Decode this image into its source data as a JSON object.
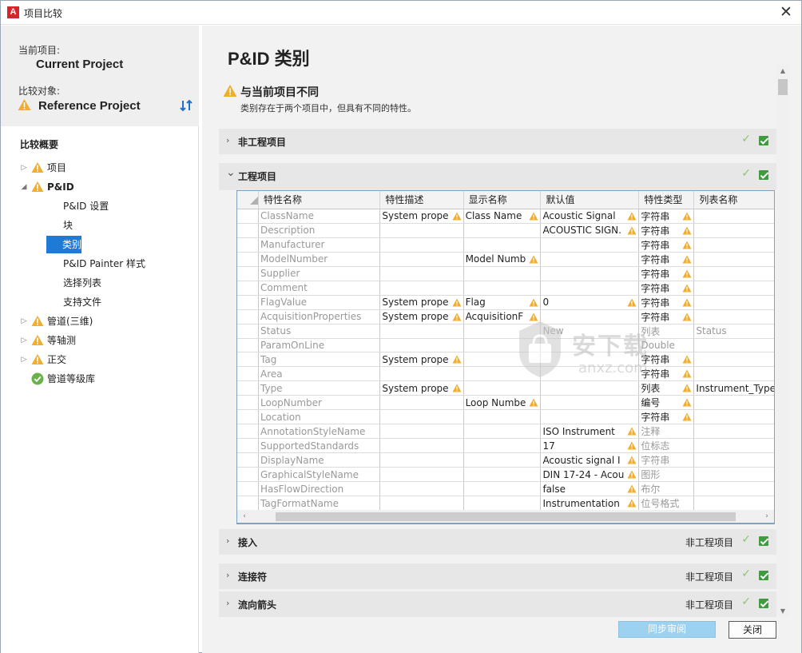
{
  "window": {
    "logo_letter": "A",
    "title": "项目比较",
    "close_glyph": "✕"
  },
  "left": {
    "current_label": "当前项目:",
    "current_name": "Current Project",
    "compare_label": "比较对象:",
    "compare_name": "Reference Project",
    "summary_title": "比较概要",
    "tree": [
      {
        "label": "项目",
        "icon": "warning-icon",
        "arrow": "▷"
      },
      {
        "label": "P&ID",
        "icon": "warning-icon",
        "arrow": "◢"
      },
      {
        "label": "管道(三维)",
        "icon": "warning-icon",
        "arrow": "▷"
      },
      {
        "label": "等轴测",
        "icon": "warning-icon",
        "arrow": "▷"
      },
      {
        "label": "正交",
        "icon": "warning-icon",
        "arrow": "▷"
      },
      {
        "label": "管道等级库",
        "icon": "check-circle-icon",
        "arrow": ""
      }
    ],
    "pid_children": [
      "P&ID 设置",
      "块",
      "类别",
      "P&ID Painter 样式",
      "选择列表",
      "支持文件"
    ],
    "selected_child": "类别"
  },
  "main": {
    "page_title": "P&ID 类别",
    "diff_title": "与当前项目不同",
    "diff_desc": "类别存在于两个项目中，但具有不同的特性。",
    "sections": [
      {
        "title": "非工程项目",
        "status": "",
        "expanded": false
      },
      {
        "title": "工程项目",
        "status": "",
        "expanded": true
      },
      {
        "title": "接入",
        "status": "非工程项目",
        "expanded": false
      },
      {
        "title": "连接符",
        "status": "非工程项目",
        "expanded": false
      },
      {
        "title": "流向箭头",
        "status": "非工程项目",
        "expanded": false
      }
    ],
    "table": {
      "columns": [
        "特性名称",
        "特性描述",
        "显示名称",
        "默认值",
        "特性类型",
        "列表名称"
      ],
      "rows": [
        {
          "name": "ClassName",
          "desc": "System prope",
          "desc_w": true,
          "disp": "Class Name",
          "disp_w": true,
          "def": "Acoustic Signal",
          "def_w": true,
          "type": "字符串",
          "type_w": true,
          "list": "",
          "list_w": false,
          "type_grey": false
        },
        {
          "name": "Description",
          "desc": "",
          "desc_w": false,
          "disp": "",
          "disp_w": false,
          "def": "ACOUSTIC SIGN.",
          "def_w": true,
          "type": "字符串",
          "type_w": true,
          "list": "",
          "list_w": false,
          "type_grey": false
        },
        {
          "name": "Manufacturer",
          "desc": "",
          "desc_w": false,
          "disp": "",
          "disp_w": false,
          "def": "",
          "def_w": false,
          "type": "字符串",
          "type_w": true,
          "list": "",
          "list_w": false,
          "type_grey": false
        },
        {
          "name": "ModelNumber",
          "desc": "",
          "desc_w": false,
          "disp": "Model Numb",
          "disp_w": true,
          "def": "",
          "def_w": false,
          "type": "字符串",
          "type_w": true,
          "list": "",
          "list_w": false,
          "type_grey": false
        },
        {
          "name": "Supplier",
          "desc": "",
          "desc_w": false,
          "disp": "",
          "disp_w": false,
          "def": "",
          "def_w": false,
          "type": "字符串",
          "type_w": true,
          "list": "",
          "list_w": false,
          "type_grey": false
        },
        {
          "name": "Comment",
          "desc": "",
          "desc_w": false,
          "disp": "",
          "disp_w": false,
          "def": "",
          "def_w": false,
          "type": "字符串",
          "type_w": true,
          "list": "",
          "list_w": false,
          "type_grey": false
        },
        {
          "name": "FlagValue",
          "desc": "System prope",
          "desc_w": true,
          "disp": "Flag",
          "disp_w": true,
          "def": "0",
          "def_w": true,
          "type": "字符串",
          "type_w": true,
          "list": "",
          "list_w": false,
          "type_grey": false
        },
        {
          "name": "AcquisitionProperties",
          "desc": "System prope",
          "desc_w": true,
          "disp": "AcquisitionF",
          "disp_w": true,
          "def": "",
          "def_w": false,
          "type": "字符串",
          "type_w": true,
          "list": "",
          "list_w": false,
          "type_grey": false
        },
        {
          "name": "Status",
          "desc": "",
          "desc_w": false,
          "disp": "",
          "disp_w": false,
          "def": "New",
          "def_w": false,
          "type": "列表",
          "type_w": false,
          "list": "Status",
          "list_w": false,
          "type_grey": true,
          "def_grey": true
        },
        {
          "name": "ParamOnLine",
          "desc": "",
          "desc_w": false,
          "disp": "",
          "disp_w": false,
          "def": "",
          "def_w": false,
          "type": "Double",
          "type_w": false,
          "list": "",
          "list_w": false,
          "type_grey": true
        },
        {
          "name": "Tag",
          "desc": "System prope",
          "desc_w": true,
          "disp": "",
          "disp_w": false,
          "def": "",
          "def_w": false,
          "type": "字符串",
          "type_w": true,
          "list": "",
          "list_w": false,
          "type_grey": false
        },
        {
          "name": "Area",
          "desc": "",
          "desc_w": false,
          "disp": "",
          "disp_w": false,
          "def": "",
          "def_w": false,
          "type": "字符串",
          "type_w": true,
          "list": "",
          "list_w": false,
          "type_grey": false
        },
        {
          "name": "Type",
          "desc": "System prope",
          "desc_w": true,
          "disp": "",
          "disp_w": false,
          "def": "",
          "def_w": false,
          "type": "列表",
          "type_w": true,
          "list": "Instrument_Types",
          "list_w": true,
          "type_grey": false
        },
        {
          "name": "LoopNumber",
          "desc": "",
          "desc_w": false,
          "disp": "Loop Numbe",
          "disp_w": true,
          "def": "",
          "def_w": false,
          "type": "编号",
          "type_w": true,
          "list": "",
          "list_w": false,
          "type_grey": false
        },
        {
          "name": "Location",
          "desc": "",
          "desc_w": false,
          "disp": "",
          "disp_w": false,
          "def": "",
          "def_w": false,
          "type": "字符串",
          "type_w": true,
          "list": "",
          "list_w": false,
          "type_grey": false
        },
        {
          "name": "AnnotationStyleName",
          "desc": "",
          "desc_w": false,
          "disp": "",
          "disp_w": false,
          "def": "ISO Instrument",
          "def_w": true,
          "type": "注释",
          "type_w": false,
          "list": "",
          "list_w": false,
          "type_grey": true
        },
        {
          "name": "SupportedStandards",
          "desc": "",
          "desc_w": false,
          "disp": "",
          "disp_w": false,
          "def": "17",
          "def_w": true,
          "type": "位标志",
          "type_w": false,
          "list": "",
          "list_w": false,
          "type_grey": true
        },
        {
          "name": "DisplayName",
          "desc": "",
          "desc_w": false,
          "disp": "",
          "disp_w": false,
          "def": "Acoustic signal I",
          "def_w": true,
          "type": "字符串",
          "type_w": false,
          "list": "",
          "list_w": false,
          "type_grey": true
        },
        {
          "name": "GraphicalStyleName",
          "desc": "",
          "desc_w": false,
          "disp": "",
          "disp_w": false,
          "def": "DIN 17-24 - Acou",
          "def_w": true,
          "type": "图形",
          "type_w": false,
          "list": "",
          "list_w": false,
          "type_grey": true
        },
        {
          "name": "HasFlowDirection",
          "desc": "",
          "desc_w": false,
          "disp": "",
          "disp_w": false,
          "def": "false",
          "def_w": true,
          "type": "布尔",
          "type_w": false,
          "list": "",
          "list_w": false,
          "type_grey": true
        },
        {
          "name": "TagFormatName",
          "desc": "",
          "desc_w": false,
          "disp": "",
          "disp_w": false,
          "def": "Instrumentation",
          "def_w": true,
          "type": "位号格式",
          "type_w": false,
          "list": "",
          "list_w": false,
          "type_grey": true
        }
      ]
    },
    "sync_button": "同步审阅",
    "close_button": "关闭"
  },
  "watermark": {
    "cn": "安下载",
    "url": "anxz.com"
  },
  "colors": {
    "warning": "#f0ad2e",
    "ok_green": "#3e9c3f",
    "selection_blue": "#1f7ad6",
    "sync_button_bg": "#9cd1ef"
  }
}
